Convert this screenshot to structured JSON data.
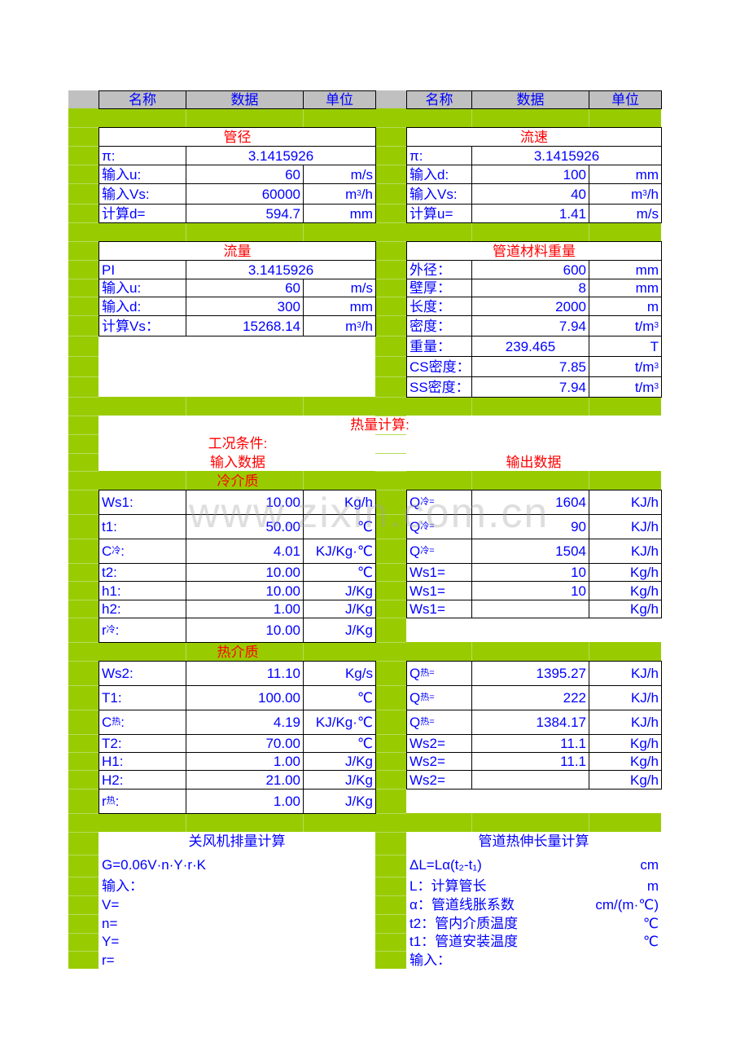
{
  "header": {
    "left": {
      "name": "名称",
      "data": "数据",
      "unit": "单位"
    },
    "right": {
      "name": "名称",
      "data": "数据",
      "unit": "单位"
    }
  },
  "pipe_diameter": {
    "title": "管径",
    "rows": [
      {
        "label": "π:",
        "value": "3.1415926",
        "unit": ""
      },
      {
        "label": "输入u:",
        "value": "60",
        "unit": "m/s"
      },
      {
        "label": "输入Vs:",
        "value": "60000",
        "unit": "m³/h"
      },
      {
        "label": "计算d=",
        "value": "594.7",
        "unit": "mm"
      }
    ]
  },
  "flow_velocity": {
    "title": "流速",
    "rows": [
      {
        "label": "π:",
        "value": "3.1415926",
        "unit": ""
      },
      {
        "label": "输入d:",
        "value": "100",
        "unit": "mm"
      },
      {
        "label": "输入Vs:",
        "value": "40",
        "unit": "m³/h"
      },
      {
        "label": "计算u=",
        "value": "1.41",
        "unit": "m/s"
      }
    ]
  },
  "flow_rate": {
    "title": "流量",
    "rows": [
      {
        "label": "PI",
        "value": "3.1415926",
        "unit": ""
      },
      {
        "label": "输入u:",
        "value": "60",
        "unit": "m/s"
      },
      {
        "label": "输入d:",
        "value": "300",
        "unit": "mm"
      },
      {
        "label": "计算Vs：",
        "value": "15268.14",
        "unit": "m³/h"
      }
    ]
  },
  "pipe_weight": {
    "title": "管道材料重量",
    "rows": [
      {
        "label": "外径：",
        "value": "600",
        "unit": "mm"
      },
      {
        "label": "壁厚：",
        "value": "8",
        "unit": "mm"
      },
      {
        "label": "长度：",
        "value": "2000",
        "unit": "m"
      },
      {
        "label": "密度：",
        "value": "7.94",
        "unit": "t/m³"
      },
      {
        "label": "重量：",
        "value": "239.465",
        "unit": "T"
      },
      {
        "label": "CS密度：",
        "value": "7.85",
        "unit": "t/m³"
      },
      {
        "label": "SS密度：",
        "value": "7.94",
        "unit": "t/m³"
      }
    ]
  },
  "heat_calc": {
    "title": "热量计算:",
    "conditions": "工况条件:",
    "input_title": "输入数据",
    "output_title": "输出数据",
    "cold_title": "冷介质",
    "hot_title": "热介质",
    "cold_inputs": [
      {
        "label": "Ws1:",
        "sub": "",
        "value": "10.00",
        "unit": "Kg/h"
      },
      {
        "label": "t1:",
        "sub": "",
        "value": "50.00",
        "unit": "℃"
      },
      {
        "label": "C",
        "sub": "冷",
        "suffix": ":",
        "value": "4.01",
        "unit": "KJ/Kg·℃"
      },
      {
        "label": "t2:",
        "sub": "",
        "value": "10.00",
        "unit": "℃"
      },
      {
        "label": "h1:",
        "sub": "",
        "value": "10.00",
        "unit": "J/Kg"
      },
      {
        "label": "h2:",
        "sub": "",
        "value": "1.00",
        "unit": "J/Kg"
      },
      {
        "label": "r",
        "sub": "冷",
        "suffix": ":",
        "value": "10.00",
        "unit": "J/Kg"
      }
    ],
    "cold_outputs": [
      {
        "label": "Q",
        "sub": "冷=",
        "value": "1604",
        "unit": "KJ/h"
      },
      {
        "label": "Q",
        "sub": "冷=",
        "value": "90",
        "unit": "KJ/h"
      },
      {
        "label": "Q",
        "sub": "冷=",
        "value": "1504",
        "unit": "KJ/h"
      },
      {
        "label": "Ws1=",
        "sub": "",
        "value": "10",
        "unit": "Kg/h"
      },
      {
        "label": "Ws1=",
        "sub": "",
        "value": "10",
        "unit": "Kg/h"
      },
      {
        "label": "Ws1=",
        "sub": "",
        "value": "",
        "unit": "Kg/h"
      }
    ],
    "hot_inputs": [
      {
        "label": "Ws2:",
        "sub": "",
        "value": "11.10",
        "unit": "Kg/s"
      },
      {
        "label": "T1:",
        "sub": "",
        "value": "100.00",
        "unit": "℃"
      },
      {
        "label": "C",
        "sub": "热",
        "suffix": ":",
        "value": "4.19",
        "unit": "KJ/Kg·℃"
      },
      {
        "label": "T2:",
        "sub": "",
        "value": "70.00",
        "unit": "℃"
      },
      {
        "label": "H1:",
        "sub": "",
        "value": "1.00",
        "unit": "J/Kg"
      },
      {
        "label": "H2:",
        "sub": "",
        "value": "21.00",
        "unit": "J/Kg"
      },
      {
        "label": "r",
        "sub": "热",
        "suffix": ":",
        "value": "1.00",
        "unit": "J/Kg"
      }
    ],
    "hot_outputs": [
      {
        "label": "Q",
        "sub": "热=",
        "value": "1395.27",
        "unit": "KJ/h"
      },
      {
        "label": "Q",
        "sub": "热=",
        "value": "222",
        "unit": "KJ/h"
      },
      {
        "label": "Q",
        "sub": "热=",
        "value": "1384.17",
        "unit": "KJ/h"
      },
      {
        "label": "Ws2=",
        "sub": "",
        "value": "11.1",
        "unit": "Kg/h"
      },
      {
        "label": "Ws2=",
        "sub": "",
        "value": "11.1",
        "unit": "Kg/h"
      },
      {
        "label": "Ws2=",
        "sub": "",
        "value": "",
        "unit": "Kg/h"
      }
    ]
  },
  "fan_calc": {
    "title": "关风机排量计算",
    "formula": "G=0.06V·n·Y·r·K",
    "lines": [
      "输入：",
      "V=",
      "n=",
      "Y=",
      "r="
    ]
  },
  "thermal_expansion": {
    "title": "管道热伸长量计算",
    "rows": [
      {
        "label": "ΔL=Lα(t₂-t₁)",
        "unit": "cm"
      },
      {
        "label": "L：计算管长",
        "unit": "m"
      },
      {
        "label": "α：管道线胀系数",
        "unit": "cm/(m·℃)"
      },
      {
        "label": "t2：管内介质温度",
        "unit": "℃"
      },
      {
        "label": "t1：管道安装温度",
        "unit": "℃"
      },
      {
        "label": "输入：",
        "unit": ""
      }
    ]
  },
  "watermark": "www.zixin.com.cn",
  "colors": {
    "band": "#99cc00",
    "header": "#c0c0c0",
    "text": "#0000ff",
    "title": "#ff0000"
  }
}
